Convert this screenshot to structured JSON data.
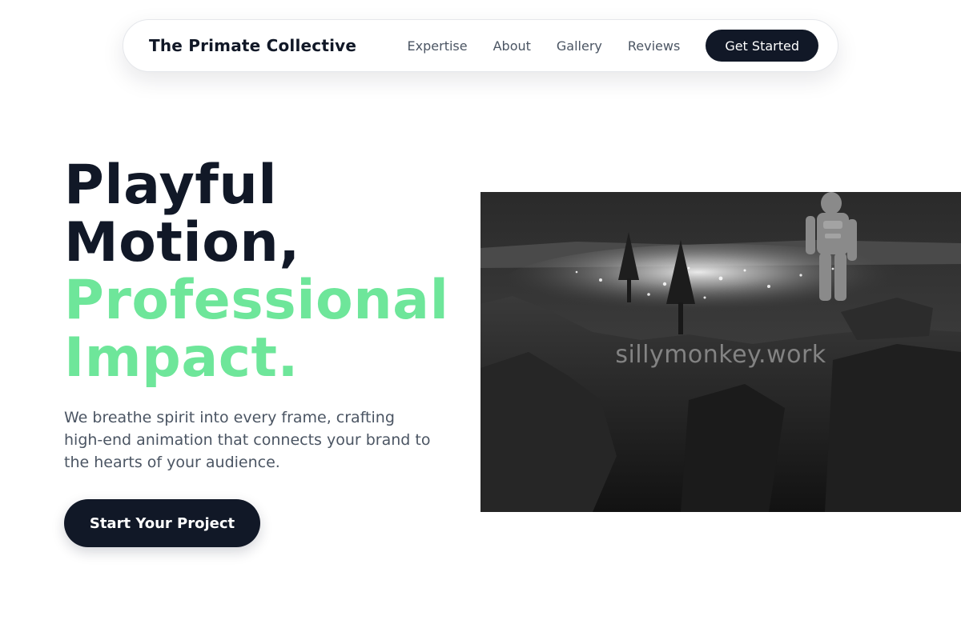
{
  "nav": {
    "brand": "The Primate Collective",
    "links": [
      "Expertise",
      "About",
      "Gallery",
      "Reviews"
    ],
    "cta": "Get Started"
  },
  "hero": {
    "title_dark_1": "Playful",
    "title_dark_2": "Motion,",
    "title_green_1": "Professional",
    "title_green_2": "Impact.",
    "description": "We breathe spirit into every frame, crafting high-end animation that connects your brand to the hearts of your audience.",
    "cta": "Start Your Project"
  },
  "image": {
    "subject": "monochrome astronaut standing on a cliff overlooking a glowing city at night",
    "watermark": "sillymonkey.work"
  },
  "colors": {
    "primary_dark": "#111827",
    "accent_green": "#6ee69a",
    "muted_text": "#4b5563"
  }
}
